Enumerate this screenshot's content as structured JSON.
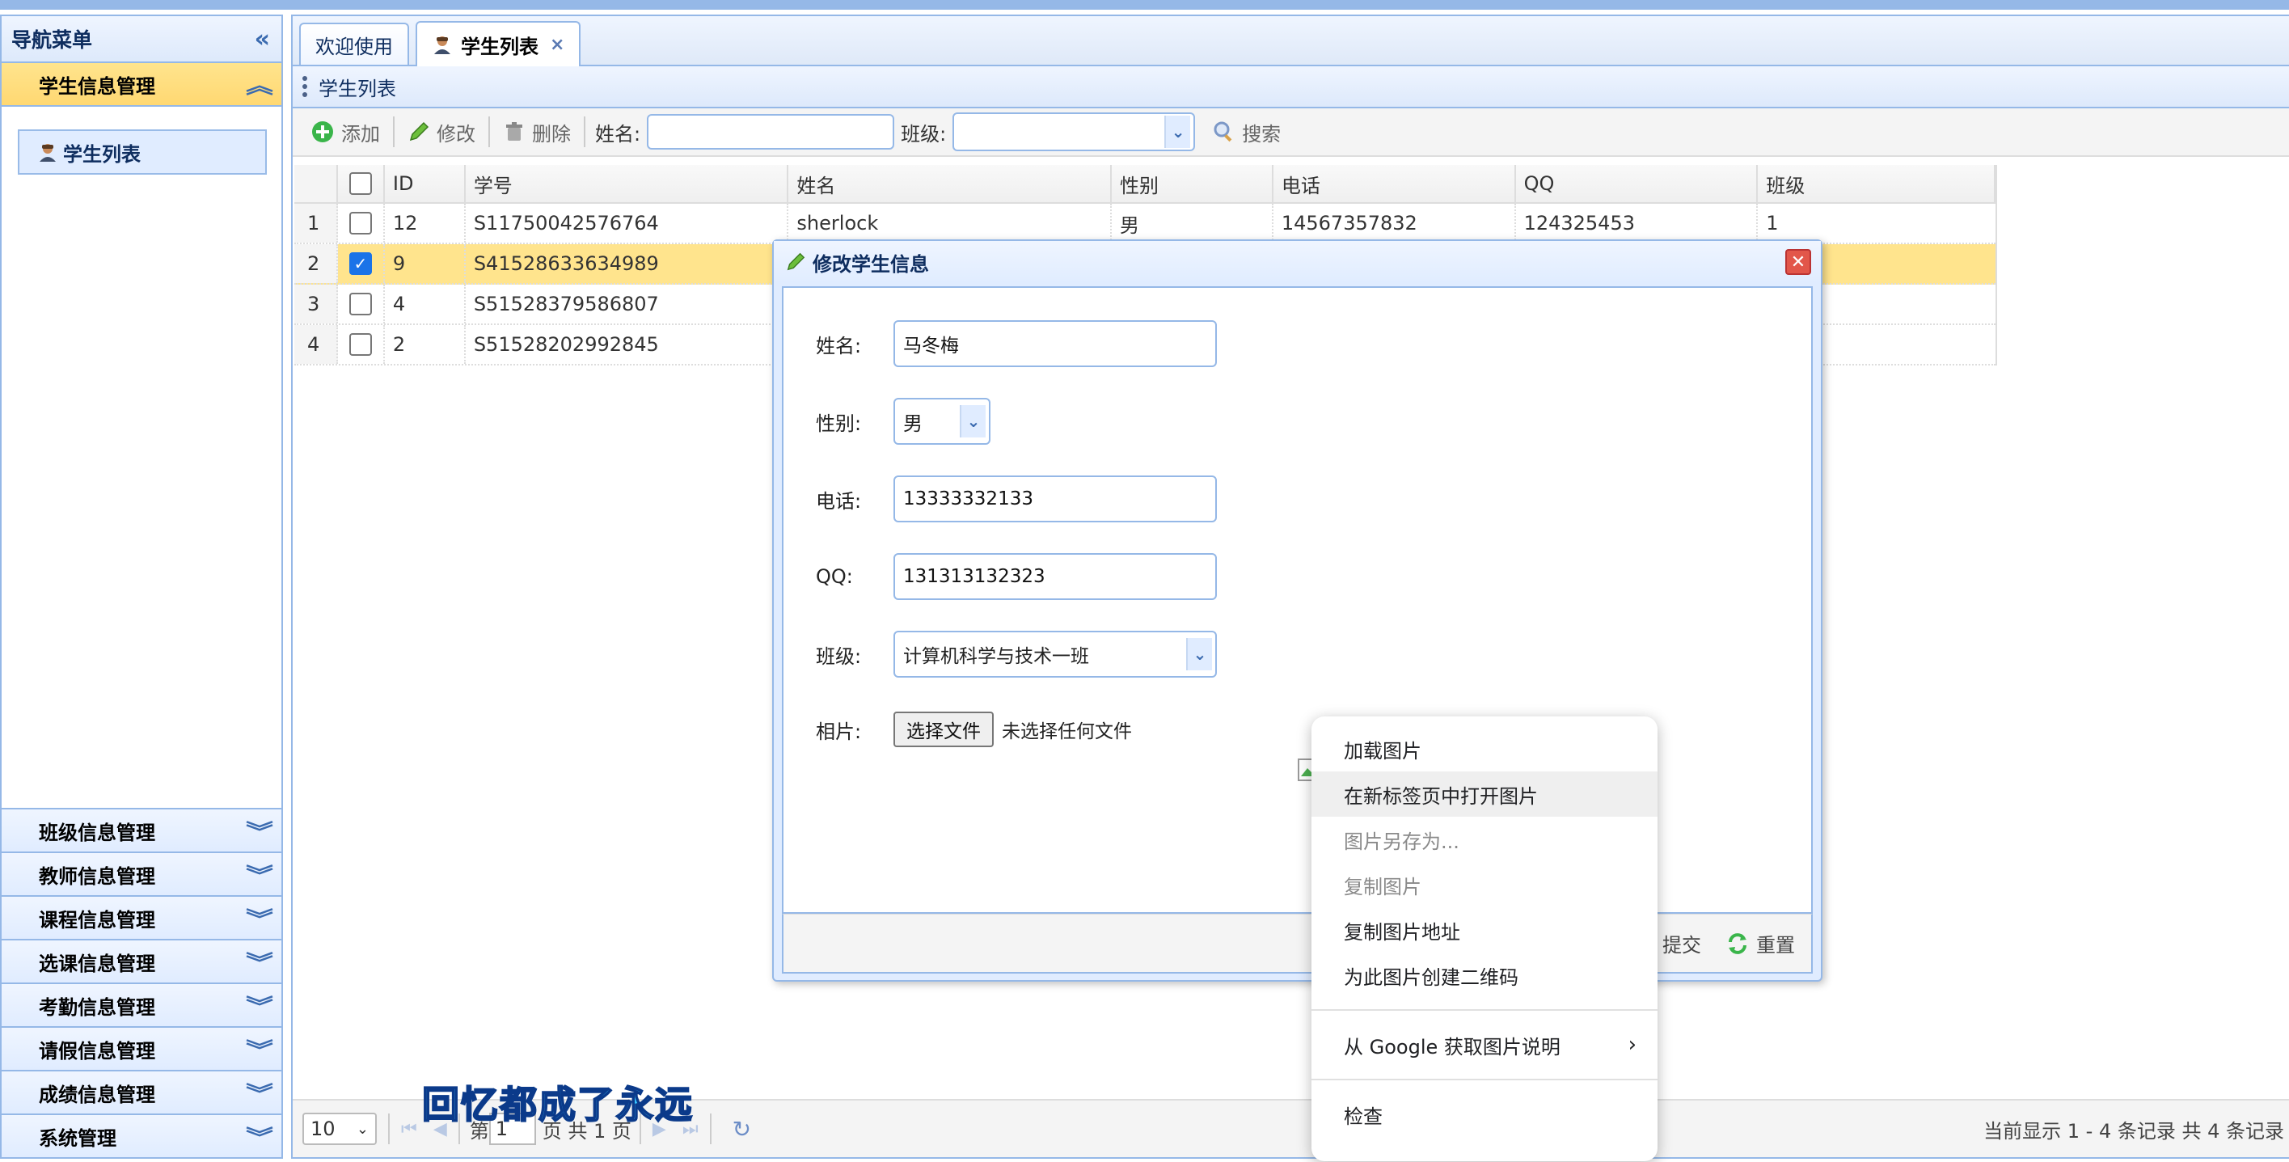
{
  "sidebar": {
    "title": "导航菜单",
    "collapse_icon": "double-chevron-left-icon",
    "open_panel": {
      "title": "学生信息管理",
      "items": [
        {
          "label": "学生列表",
          "icon": "student-avatar-icon"
        }
      ]
    },
    "panels": [
      {
        "title": "班级信息管理"
      },
      {
        "title": "教师信息管理"
      },
      {
        "title": "课程信息管理"
      },
      {
        "title": "选课信息管理"
      },
      {
        "title": "考勤信息管理"
      },
      {
        "title": "请假信息管理"
      },
      {
        "title": "成绩信息管理"
      },
      {
        "title": "系统管理"
      }
    ]
  },
  "tabs": [
    {
      "label": "欢迎使用",
      "active": false
    },
    {
      "label": "学生列表",
      "active": true,
      "closable": true,
      "close_glyph": "×"
    }
  ],
  "panel_title": "学生列表",
  "toolbar": {
    "add_label": "添加",
    "edit_label": "修改",
    "delete_label": "删除",
    "name_label": "姓名:",
    "name_value": "",
    "class_label": "班级:",
    "class_value": "",
    "search_label": "搜索"
  },
  "table": {
    "columns": [
      "ID",
      "学号",
      "姓名",
      "性别",
      "电话",
      "QQ",
      "班级"
    ],
    "rows": [
      {
        "num": "1",
        "checked": false,
        "cells": [
          "12",
          "S11750042576764",
          "sherlock",
          "男",
          "14567357832",
          "124325453",
          "1"
        ]
      },
      {
        "num": "2",
        "checked": true,
        "cells": [
          "9",
          "S41528633634989",
          "",
          "",
          "",
          "",
          ""
        ]
      },
      {
        "num": "3",
        "checked": false,
        "cells": [
          "4",
          "S51528379586807",
          "",
          "",
          "",
          "",
          ""
        ]
      },
      {
        "num": "4",
        "checked": false,
        "cells": [
          "2",
          "S51528202992845",
          "",
          "",
          "",
          "",
          ""
        ]
      }
    ]
  },
  "pager": {
    "page_size": "10",
    "page_prefix": "第",
    "page_value": "1",
    "page_suffix": "页 共 1 页",
    "info": "当前显示 1 - 4 条记录 共 4 条记录"
  },
  "dialog": {
    "title": "修改学生信息",
    "fields": {
      "name_label": "姓名:",
      "name_value": "马冬梅",
      "sex_label": "性别:",
      "sex_value": "男",
      "phone_label": "电话:",
      "phone_value": "13333332133",
      "qq_label": "QQ:",
      "qq_value": "131313132323",
      "class_label": "班级:",
      "class_value": "计算机科学与技术一班",
      "photo_label": "相片:",
      "file_button": "选择文件",
      "file_status": "未选择任何文件"
    },
    "footer": {
      "submit_label": "提交",
      "reset_label": "重置"
    }
  },
  "context_menu": {
    "items": [
      {
        "label": "加载图片"
      },
      {
        "label": "在新标签页中打开图片",
        "highlighted": true
      },
      {
        "label": "图片另存为...",
        "disabled": true
      },
      {
        "label": "复制图片",
        "disabled": true
      },
      {
        "label": "复制图片地址"
      },
      {
        "label": "为此图片创建二维码"
      }
    ],
    "google_item": "从 Google 获取图片说明",
    "inspect_item": "检查"
  },
  "subtitle": "回忆都成了永远",
  "colors": {
    "border": "#95b8e7",
    "header_bg": "#e0ecff",
    "selected_row": "#ffe48d",
    "accent": "#1a73e8"
  }
}
